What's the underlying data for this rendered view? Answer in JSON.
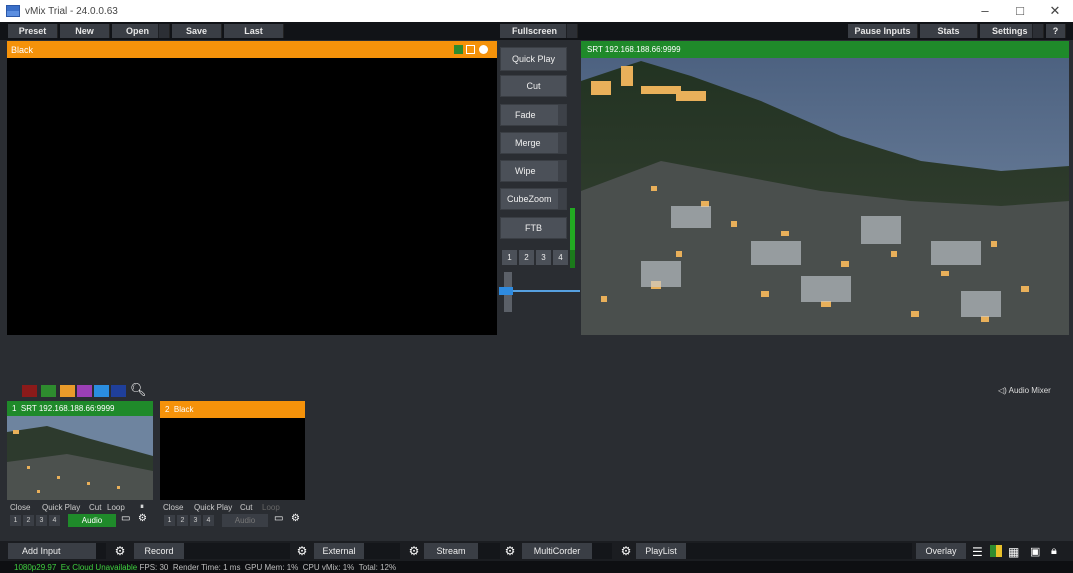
{
  "window": {
    "title": "vMix Trial - 24.0.0.63"
  },
  "toolbar": {
    "preset": "Preset",
    "new": "New",
    "open": "Open",
    "save": "Save",
    "last": "Last",
    "fullscreen": "Fullscreen",
    "pause_inputs": "Pause Inputs",
    "stats": "Stats",
    "settings": "Settings",
    "help": "?"
  },
  "preview": {
    "label": "Black"
  },
  "output": {
    "label": "SRT 192.168.188.66:9999"
  },
  "transitions": {
    "quick_play": "Quick Play",
    "cut": "Cut",
    "fade": "Fade",
    "merge": "Merge",
    "wipe": "Wipe",
    "cube_zoom": "CubeZoom",
    "ftb": "FTB",
    "numbers": [
      "1",
      "2",
      "3",
      "4"
    ]
  },
  "audio": {
    "label": "Audio Mixer"
  },
  "colors": {
    "accent_orange": "#f5920a",
    "accent_green": "#1f8a2a",
    "swatches": [
      "#8b1a1a",
      "#2e8b2e",
      "#e89a2a",
      "#9b3fb5",
      "#2a8de0",
      "#1f3f9a"
    ]
  },
  "inputs": [
    {
      "number": "1",
      "name": "SRT 192.168.188.66:9999",
      "close": "Close",
      "quick_play": "Quick Play",
      "cut": "Cut",
      "loop": "Loop",
      "numbers": [
        "1",
        "2",
        "3",
        "4"
      ],
      "audio": "Audio"
    },
    {
      "number": "2",
      "name": "Black",
      "close": "Close",
      "quick_play": "Quick Play",
      "cut": "Cut",
      "loop": "Loop",
      "numbers": [
        "1",
        "2",
        "3",
        "4"
      ],
      "audio": "Audio"
    }
  ],
  "bottom": {
    "add_input": "Add Input",
    "record": "Record",
    "external": "External",
    "stream": "Stream",
    "multicorder": "MultiCorder",
    "playlist": "PlayList",
    "overlay": "Overlay"
  },
  "status": {
    "resolution": "1080p29.97",
    "ex_label": "Ex",
    "ex_value": "Cloud Unavailable",
    "fps_label": "FPS:",
    "fps_value": "30",
    "render_label": "Render Time:",
    "render_value": "1 ms",
    "gpu_label": "GPU Mem:",
    "gpu_value": "1%",
    "cpu_label": "CPU vMix:",
    "cpu_value": "1%",
    "total_label": "Total:",
    "total_value": "12%"
  }
}
